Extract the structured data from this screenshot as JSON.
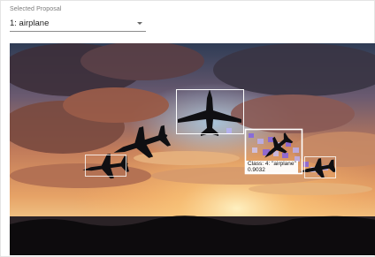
{
  "proposal_select": {
    "label": "Selected Proposal",
    "value": "1: airplane"
  },
  "detection": {
    "class_text": "Class: 4: \"airplane\"",
    "score_text": "0.9032"
  },
  "icons": {
    "dropdown": "chevron-down-icon"
  },
  "colors": {
    "box_stroke": "#ffffff",
    "heatmap": "#7a5cf0",
    "sky_top": "#3b4a63",
    "sun_glow": "#ffd58a"
  }
}
